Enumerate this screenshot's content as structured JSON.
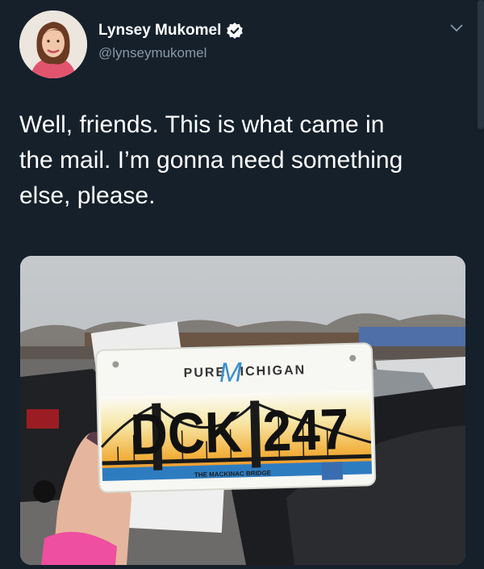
{
  "tweet": {
    "display_name": "Lynsey Mukomel",
    "handle": "@lynseymukomel",
    "text": "Well, friends. This is what came in\nthe mail. I’m gonna need something\nelse, please.",
    "icons": {
      "verified": "verified-badge-icon",
      "menu": "chevron-down-icon"
    }
  },
  "media": {
    "plate": {
      "header_left": "PURE",
      "header_script": "M",
      "header_right": "ICHIGAN",
      "number_left": "DCK",
      "number_right": "247",
      "footer": "THE MACKINAC BRIDGE"
    }
  },
  "colors": {
    "background": "#15202b",
    "verified": "#ffffff",
    "handle": "#8899a6"
  }
}
